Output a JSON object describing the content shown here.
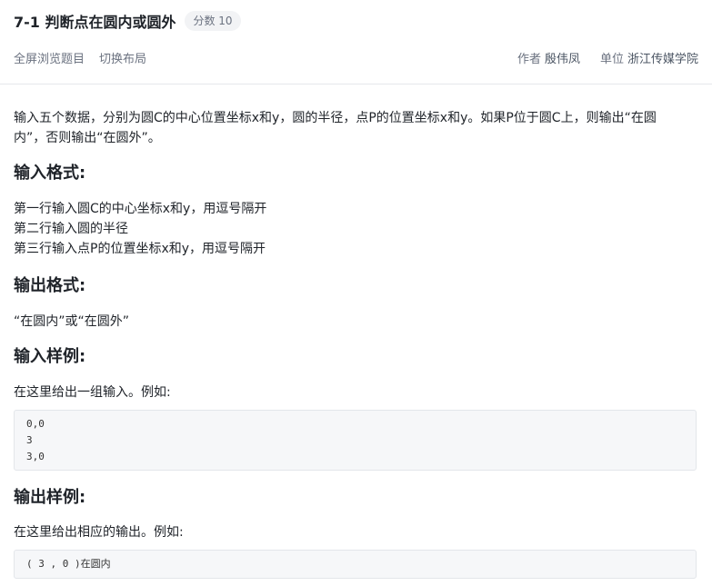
{
  "header": {
    "title": "7-1 判断点在圆内或圆外",
    "score_badge": "分数 10",
    "fullscreen_label": "全屏浏览题目",
    "layout_label": "切换布局",
    "author_label": "作者",
    "author_name": "殷伟凤",
    "org_label": "单位",
    "org_name": "浙江传媒学院"
  },
  "problem": {
    "description_lines": [
      "输入五个数据，分别为圆C的中心位置坐标x和y，圆的半径，点P的位置坐标x和y。如果P位于圆C上，则输出“在圆",
      "内”，否则输出“在圆外”。"
    ],
    "input_format_heading": "输入格式:",
    "input_format_lines": [
      "第一行输入圆C的中心坐标x和y，用逗号隔开",
      "第二行输入圆的半径",
      "第三行输入点P的位置坐标x和y，用逗号隔开"
    ],
    "output_format_heading": "输出格式:",
    "output_format_text": "“在圆内”或“在圆外”",
    "sample_input_heading": "输入样例:",
    "sample_input_intro": "在这里给出一组输入。例如:",
    "sample_input_lines": [
      "0,0",
      "3",
      "3,0"
    ],
    "sample_output_heading": "输出样例:",
    "sample_output_intro": "在这里给出相应的输出。例如:",
    "sample_output_lines": [
      "( 3 , 0 )在圆内"
    ]
  }
}
